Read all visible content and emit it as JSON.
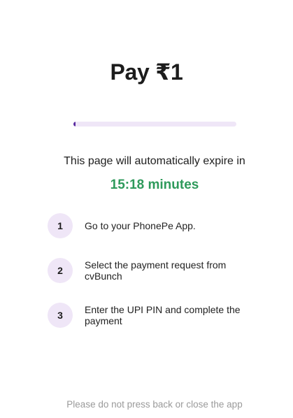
{
  "header": {
    "title": "Pay ₹1"
  },
  "progress": {
    "fraction": 0.01,
    "track_color": "#efe6f7",
    "fill_color": "#5a2ca0"
  },
  "expiry": {
    "label": "This page will automatically expire in",
    "timer": "15:18 minutes",
    "timer_color": "#2e9a5b"
  },
  "steps": [
    {
      "number": "1",
      "text": "Go to your PhonePe App."
    },
    {
      "number": "2",
      "text": "Select the payment request from cvBunch"
    },
    {
      "number": "3",
      "text": "Enter the UPI PIN and complete the payment"
    }
  ],
  "footer": {
    "notice": "Please do not press back or close the app"
  }
}
